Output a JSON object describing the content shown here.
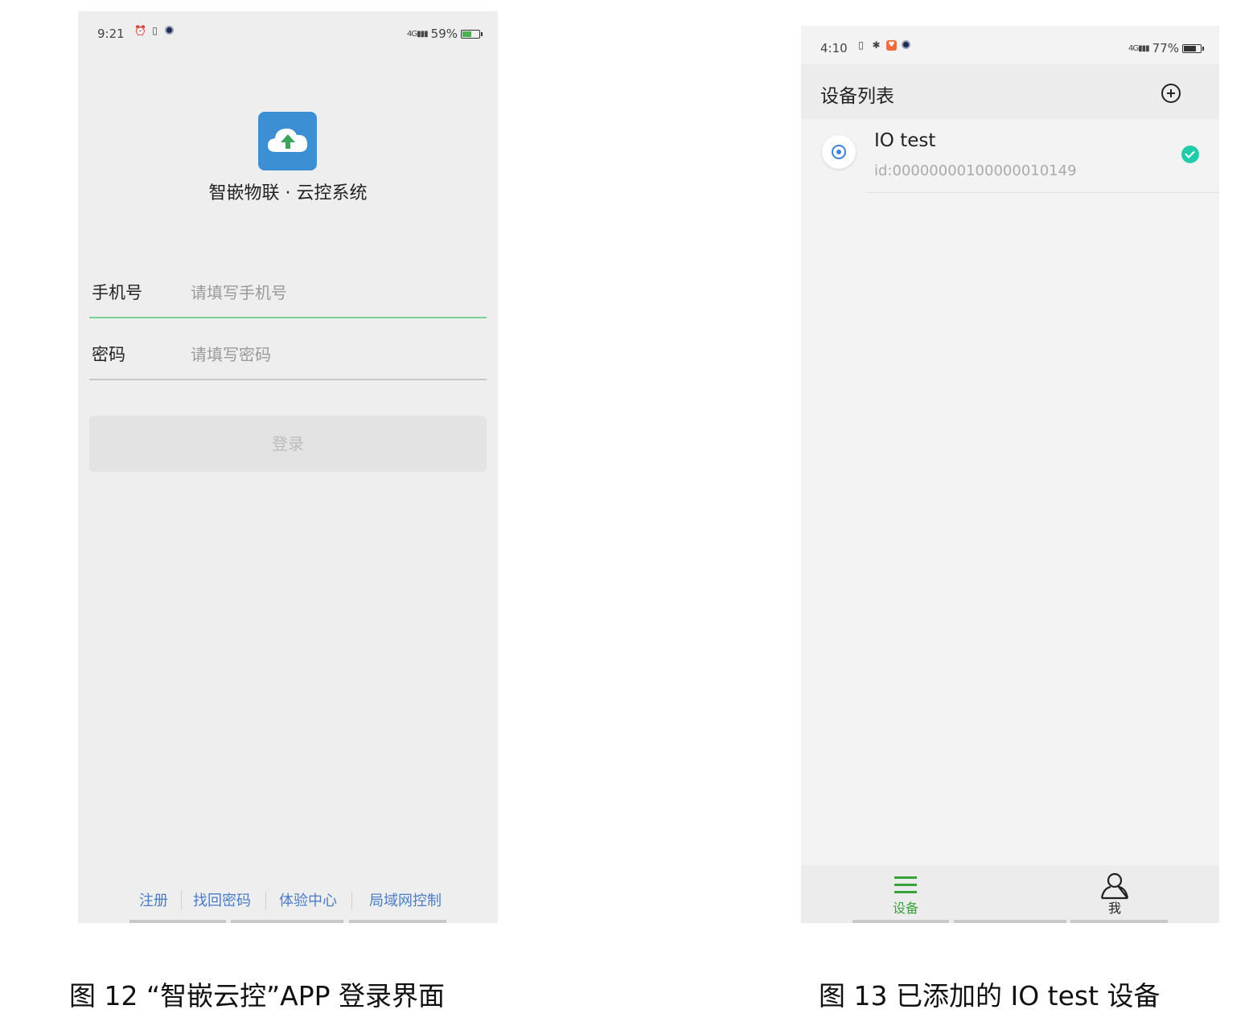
{
  "login_screen": {
    "status": {
      "time": "9:21",
      "network": "4G",
      "battery": "59%",
      "battery_level": 0.59
    },
    "app_name": "智嵌物联 · 云控系统",
    "phone_field": {
      "label": "手机号",
      "placeholder": "请填写手机号"
    },
    "password_field": {
      "label": "密码",
      "placeholder": "请填写密码"
    },
    "login_button": "登录",
    "links": [
      "注册",
      "找回密码",
      "体验中心",
      "局域网控制"
    ],
    "icons": [
      "cloud-upload-icon",
      "alarm-icon",
      "vibrate-icon",
      "camera-dot-icon"
    ],
    "accent_color": "#7bd19a",
    "link_color": "#4a7cc4"
  },
  "devices_screen": {
    "status": {
      "time": "4:10",
      "network": "4G",
      "battery": "77%",
      "battery_level": 0.77
    },
    "header_title": "设备列表",
    "devices": [
      {
        "name": "IO test",
        "id": "id:00000000100000010149",
        "status": "online"
      }
    ],
    "tabs": [
      {
        "label": "设备",
        "icon": "menu-icon",
        "active": true
      },
      {
        "label": "我",
        "icon": "person-icon",
        "active": false
      }
    ],
    "active_color": "#3aa23a",
    "check_color": "#22ccaa"
  },
  "captions": {
    "fig12": "图 12 “智嵌云控”APP 登录界面",
    "fig13": "图 13 已添加的 IO test 设备"
  }
}
